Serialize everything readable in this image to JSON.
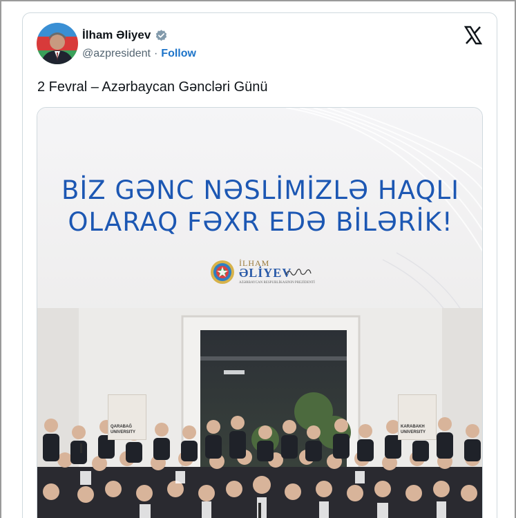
{
  "tweet": {
    "user_name": "İlham Əliyev",
    "handle": "@azpresident",
    "separator": "·",
    "follow_label": "Follow",
    "text": "2 Fevral – Azərbaycan Gəncləri Günü"
  },
  "media": {
    "headline_line1": "BİZ GƏNC NƏSLİMİZLƏ HAQLI",
    "headline_line2": "OLARAQ FƏXR EDƏ BİLƏRİK!",
    "logo_name_top": "İLHAM",
    "logo_name_bottom": "ƏLİYEV",
    "logo_subtitle": "AZƏRBAYCAN RESPUBLİKASININ PREZİDENTİ",
    "plaque_left_text": "QARABAĞ UNIVERSITY",
    "plaque_right_text": "KARABAKH UNIVERSITY"
  },
  "icons": {
    "verified": "verified-badge-icon",
    "x_logo": "x-logo-icon"
  },
  "colors": {
    "headline_blue": "#1c57b3",
    "follow_blue": "#1d74c9",
    "verified_gray": "#829aab"
  }
}
